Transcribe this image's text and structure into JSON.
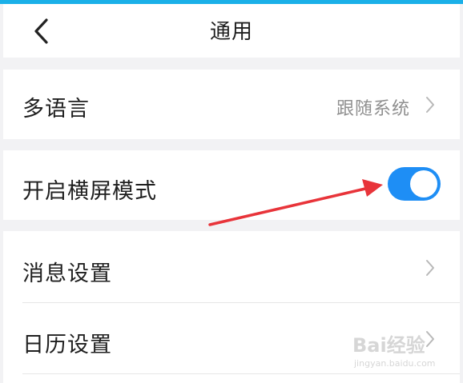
{
  "header": {
    "title": "通用",
    "back_icon": "chevron-left-icon"
  },
  "settings": {
    "language": {
      "label": "多语言",
      "value": "跟随系统",
      "icon": "chevron-right-icon"
    },
    "landscape_mode": {
      "label": "开启横屏模式",
      "enabled": true
    },
    "message_settings": {
      "label": "消息设置",
      "icon": "chevron-right-icon"
    },
    "calendar_settings": {
      "label": "日历设置",
      "icon": "chevron-right-icon"
    }
  },
  "colors": {
    "accent": "#1e8ef5",
    "top_strip": "#1ab0e8",
    "annotation_arrow": "#e8343a"
  },
  "watermark": {
    "logo": "Bai经验",
    "url": "jingyan.baidu.com"
  }
}
